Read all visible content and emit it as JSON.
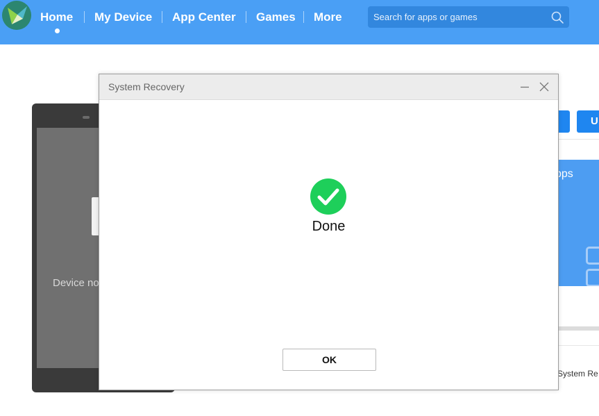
{
  "nav": {
    "items": [
      {
        "label": "Home"
      },
      {
        "label": "My Device"
      },
      {
        "label": "App Center"
      },
      {
        "label": "Games"
      },
      {
        "label": "More"
      }
    ],
    "active": "Home",
    "logo_icon": "bird-logo-icon"
  },
  "search": {
    "placeholder": "Search for apps or games",
    "icon": "search-icon"
  },
  "background": {
    "device_status": "Device no",
    "button_partial": "U",
    "banner_text": "pps",
    "caption": "System Re"
  },
  "dialog": {
    "title": "System Recovery",
    "status_text": "Done",
    "status_icon": "check-circle-icon",
    "ok_label": "OK"
  },
  "colors": {
    "topbar": "#4a9ff5",
    "accent": "#1f86f0",
    "success": "#1ecf5a"
  }
}
